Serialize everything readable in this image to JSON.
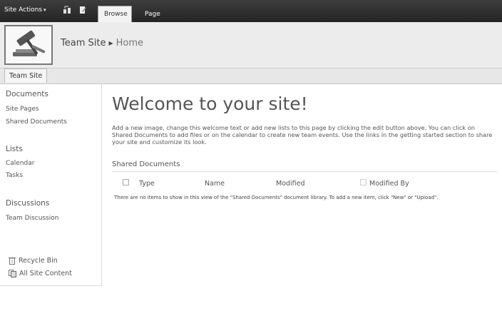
{
  "ribbon": {
    "site_actions": "Site Actions",
    "tabs": [
      "Browse",
      "Page"
    ]
  },
  "header": {
    "site_name": "Team Site",
    "current_page": "Home"
  },
  "topnav": {
    "items": [
      "Team Site"
    ]
  },
  "leftnav": {
    "sections": [
      {
        "title": "Documents",
        "items": [
          "Site Pages",
          "Shared Documents"
        ]
      },
      {
        "title": "Lists",
        "items": [
          "Calendar",
          "Tasks"
        ]
      },
      {
        "title": "Discussions",
        "items": [
          "Team Discussion"
        ]
      }
    ],
    "recycle_bin": "Recycle Bin",
    "all_site_content": "All Site Content"
  },
  "main": {
    "title": "Welcome to your site!",
    "description": "Add a new image, change this welcome text or add new lists to this page by clicking the edit button above. You can click on Shared Documents to add files or on the calendar to create new team events. Use the links in the getting started section to share your site and customize its look.",
    "shared_docs": {
      "title": "Shared Documents",
      "columns": [
        "Type",
        "Name",
        "Modified",
        "Modified By"
      ],
      "empty_message": "There are no items to show in this view of the \"Shared Documents\" document library. To add a new item, click \"New\" or \"Upload\"."
    }
  }
}
